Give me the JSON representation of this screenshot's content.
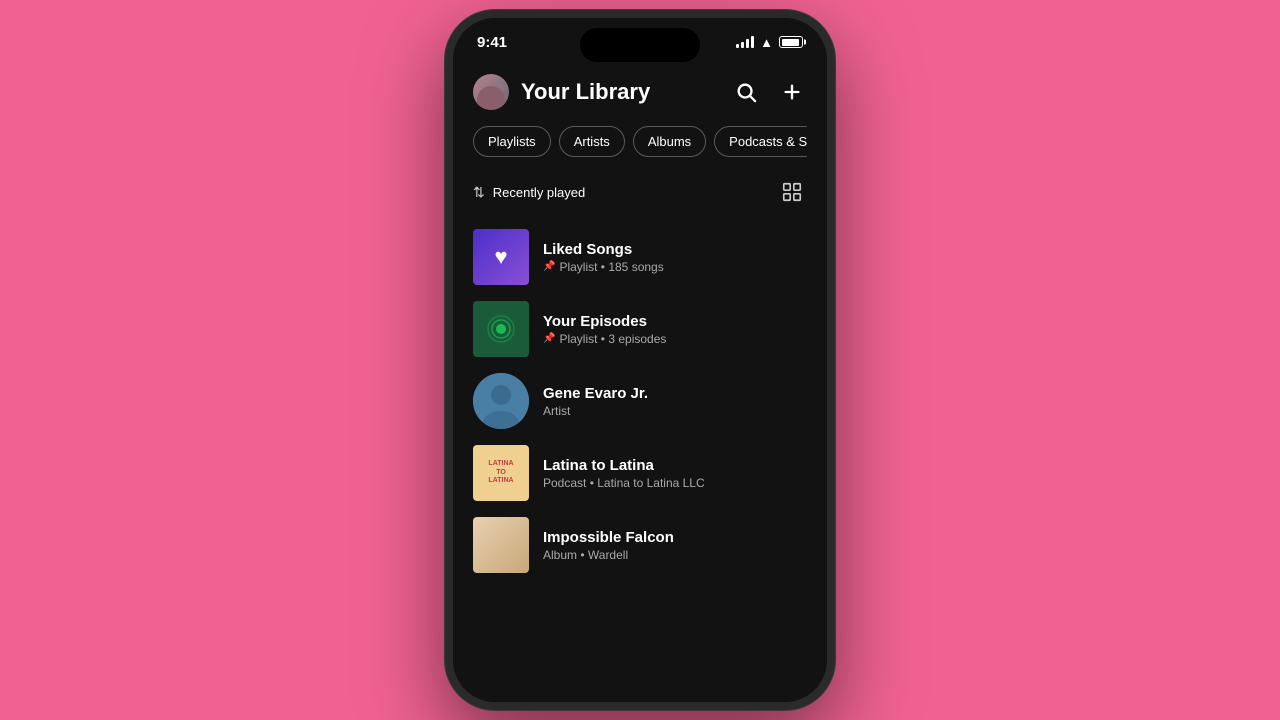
{
  "status": {
    "time": "9:41"
  },
  "header": {
    "title": "Your Library",
    "search_label": "search",
    "add_label": "add"
  },
  "filters": [
    {
      "id": "playlists",
      "label": "Playlists"
    },
    {
      "id": "artists",
      "label": "Artists"
    },
    {
      "id": "albums",
      "label": "Albums"
    },
    {
      "id": "podcasts",
      "label": "Podcasts & Sho"
    }
  ],
  "sort": {
    "label": "Recently played"
  },
  "items": [
    {
      "id": "liked-songs",
      "title": "Liked Songs",
      "subtitle": "Playlist • 185 songs",
      "type": "liked",
      "pinned": true
    },
    {
      "id": "your-episodes",
      "title": "Your Episodes",
      "subtitle": "Playlist • 3 episodes",
      "type": "episodes",
      "pinned": true
    },
    {
      "id": "gene-evaro",
      "title": "Gene Evaro Jr.",
      "subtitle": "Artist",
      "type": "artist",
      "pinned": false
    },
    {
      "id": "latina-to-latina",
      "title": "Latina to Latina",
      "subtitle": "Podcast • Latina to Latina LLC",
      "type": "podcast",
      "pinned": false
    },
    {
      "id": "impossible-falcon",
      "title": "Impossible Falcon",
      "subtitle": "Album • Wardell",
      "type": "album",
      "pinned": false
    }
  ]
}
